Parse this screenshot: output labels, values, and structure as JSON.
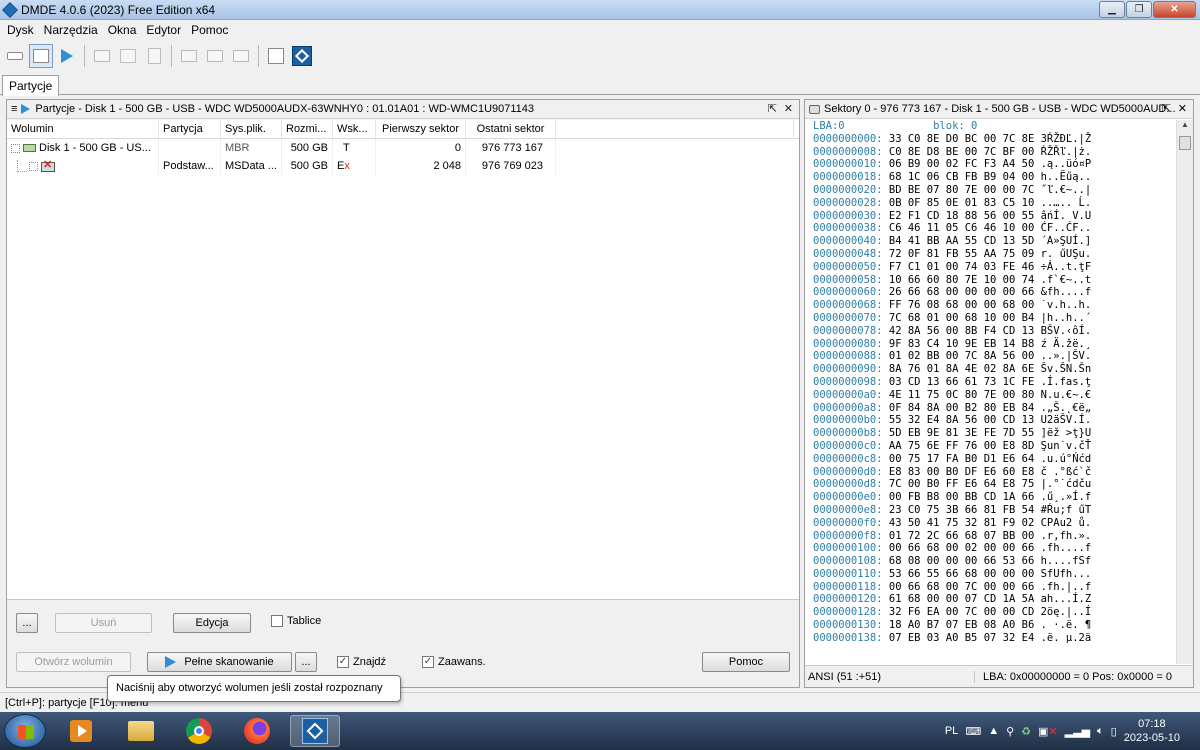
{
  "window": {
    "title": "DMDE 4.0.6 (2023) Free Edition x64",
    "min": "▁",
    "max": "❐",
    "close": "✕"
  },
  "menu": [
    "Dysk",
    "Narzędzia",
    "Okna",
    "Edytor",
    "Pomoc"
  ],
  "tabs": [
    {
      "label": "Partycje"
    }
  ],
  "left_panel": {
    "title": "Partycje - Disk 1 - 500 GB - USB - WDC WD5000AUDX-63WNHY0 : 01.01A01 : WD-WMC1U9071143",
    "columns": [
      "Wolumin",
      "Partycja",
      "Sys.plik.",
      "Rozmi...",
      "Wsk...",
      "Pierwszy sektor",
      "Ostatni sektor"
    ],
    "rows": [
      {
        "name": "Disk 1 - 500 GB - US...",
        "partition": "",
        "fs": "MBR",
        "size": "500 GB",
        "flag": "T",
        "flag_extra": "",
        "first": "0",
        "last": "976 773 167"
      },
      {
        "name": "",
        "partition": "Podstaw...",
        "fs": "MSData ...",
        "size": "500 GB",
        "flag": "E",
        "flag_extra": "x",
        "first": "2 048",
        "last": "976 769 023"
      }
    ],
    "buttons": {
      "more1": "...",
      "remove": "Usuń",
      "edit": "Edycja",
      "tables": "Tablice",
      "open_volume": "Otwórz wolumin",
      "full_scan": "Pełne skanowanie",
      "more2": "...",
      "find": "Znajdź",
      "advanced": "Zaawans.",
      "help": "Pomoc"
    },
    "tooltip": "Naciśnij aby otworzyć wolumen jeśli został rozpoznany"
  },
  "right_panel": {
    "title": "Sektory 0 - 976 773 167 - Disk 1 - 500 GB - USB - WDC WD5000AUD...",
    "header": "LBA:0              blok: 0",
    "hex_lines": [
      {
        "addr": "0000000000:",
        "bytes": "33 C0 8E D0 BC 00 7C 8E",
        "ascii": "3ŔŽĐĽ.|Ž"
      },
      {
        "addr": "0000000008:",
        "bytes": "C0 8E D8 BE 00 7C BF 00",
        "ascii": "ŔŽŘľ.|ż."
      },
      {
        "addr": "0000000010:",
        "bytes": "06 B9 00 02 FC F3 A4 50",
        "ascii": ".ą..üó¤P"
      },
      {
        "addr": "0000000018:",
        "bytes": "68 1C 06 CB FB B9 04 00",
        "ascii": "h..Ëűą.."
      },
      {
        "addr": "0000000020:",
        "bytes": "BD BE 07 80 7E 00 00 7C",
        "ascii": "˝ľ.€~..|"
      },
      {
        "addr": "0000000028:",
        "bytes": "0B 0F 85 0E 01 83 C5 10",
        "ascii": "..….. Ĺ."
      },
      {
        "addr": "0000000030:",
        "bytes": "E2 F1 CD 18 88 56 00 55",
        "ascii": "âńÍ. V.U"
      },
      {
        "addr": "0000000038:",
        "bytes": "C6 46 11 05 C6 46 10 00",
        "ascii": "ĆF..ĆF.."
      },
      {
        "addr": "0000000040:",
        "bytes": "B4 41 BB AA 55 CD 13 5D",
        "ascii": "´A»ŞUÍ.]"
      },
      {
        "addr": "0000000048:",
        "bytes": "72 0F 81 FB 55 AA 75 09",
        "ascii": "r. űUŞu."
      },
      {
        "addr": "0000000050:",
        "bytes": "F7 C1 01 00 74 03 FE 46",
        "ascii": "÷Á..t.ţF"
      },
      {
        "addr": "0000000058:",
        "bytes": "10 66 60 80 7E 10 00 74",
        "ascii": ".f`€~..t"
      },
      {
        "addr": "0000000060:",
        "bytes": "26 66 68 00 00 00 00 66",
        "ascii": "&fh....f"
      },
      {
        "addr": "0000000068:",
        "bytes": "FF 76 08 68 00 00 68 00",
        "ascii": "˙v.h..h."
      },
      {
        "addr": "0000000070:",
        "bytes": "7C 68 01 00 68 10 00 B4",
        "ascii": "|h..h..´"
      },
      {
        "addr": "0000000078:",
        "bytes": "42 8A 56 00 8B F4 CD 13",
        "ascii": "BŠV.‹ôÍ."
      },
      {
        "addr": "0000000080:",
        "bytes": "9F 83 C4 10 9E EB 14 B8",
        "ascii": "ź Ä.žë.¸"
      },
      {
        "addr": "0000000088:",
        "bytes": "01 02 BB 00 7C 8A 56 00",
        "ascii": "..».|ŠV."
      },
      {
        "addr": "0000000090:",
        "bytes": "8A 76 01 8A 4E 02 8A 6E",
        "ascii": "Šv.ŠN.Šn"
      },
      {
        "addr": "0000000098:",
        "bytes": "03 CD 13 66 61 73 1C FE",
        "ascii": ".Í.fas.ţ"
      },
      {
        "addr": "00000000a0:",
        "bytes": "4E 11 75 0C 80 7E 00 80",
        "ascii": "N.u.€~.€"
      },
      {
        "addr": "00000000a8:",
        "bytes": "0F 84 8A 00 B2 80 EB 84",
        "ascii": ".„Š.˛€ë„"
      },
      {
        "addr": "00000000b0:",
        "bytes": "55 32 E4 8A 56 00 CD 13",
        "ascii": "U2äŠV.Í."
      },
      {
        "addr": "00000000b8:",
        "bytes": "5D EB 9E 81 3E FE 7D 55",
        "ascii": "]ëž >ţ}U"
      },
      {
        "addr": "00000000c0:",
        "bytes": "AA 75 6E FF 76 00 E8 8D",
        "ascii": "Şun˙v.čŤ"
      },
      {
        "addr": "00000000c8:",
        "bytes": "00 75 17 FA B0 D1 E6 64",
        "ascii": ".u.ú°Ńćd"
      },
      {
        "addr": "00000000d0:",
        "bytes": "E8 83 00 B0 DF E6 60 E8",
        "ascii": "č .°ßć`č"
      },
      {
        "addr": "00000000d8:",
        "bytes": "7C 00 B0 FF E6 64 E8 75",
        "ascii": "|.°˙ćdču"
      },
      {
        "addr": "00000000e0:",
        "bytes": "00 FB B8 00 BB CD 1A 66",
        "ascii": ".ű¸.»Í.f"
      },
      {
        "addr": "00000000e8:",
        "bytes": "23 C0 75 3B 66 81 FB 54",
        "ascii": "#Ŕu;f űT"
      },
      {
        "addr": "00000000f0:",
        "bytes": "43 50 41 75 32 81 F9 02",
        "ascii": "CPAu2 ů."
      },
      {
        "addr": "00000000f8:",
        "bytes": "01 72 2C 66 68 07 BB 00",
        "ascii": ".r,fh.»."
      },
      {
        "addr": "0000000100:",
        "bytes": "00 66 68 00 02 00 00 66",
        "ascii": ".fh....f"
      },
      {
        "addr": "0000000108:",
        "bytes": "68 08 00 00 00 66 53 66",
        "ascii": "h....fSf"
      },
      {
        "addr": "0000000110:",
        "bytes": "53 66 55 66 68 00 00 00",
        "ascii": "SfUfh..."
      },
      {
        "addr": "0000000118:",
        "bytes": "00 66 68 00 7C 00 00 66",
        "ascii": ".fh.|..f"
      },
      {
        "addr": "0000000120:",
        "bytes": "61 68 00 00 07 CD 1A 5A",
        "ascii": "ah...Í.Z"
      },
      {
        "addr": "0000000128:",
        "bytes": "32 F6 EA 00 7C 00 00 CD",
        "ascii": "2öę.|..Í"
      },
      {
        "addr": "0000000130:",
        "bytes": "18 A0 B7 07 EB 08 A0 B6",
        "ascii": ". ·.ë. ¶"
      },
      {
        "addr": "0000000138:",
        "bytes": "07 EB 03 A0 B5 07 32 E4",
        "ascii": ".ë. µ.2ä"
      }
    ],
    "status_left": "ANSI (51 :+51)",
    "status_right": "LBA: 0x00000000 = 0  Pos: 0x0000 = 0"
  },
  "statusbar": "[Ctrl+P]: partycje  [F10]: menu",
  "taskbar": {
    "lang": "PL",
    "time": "07:18",
    "date": "2023-05-10"
  }
}
